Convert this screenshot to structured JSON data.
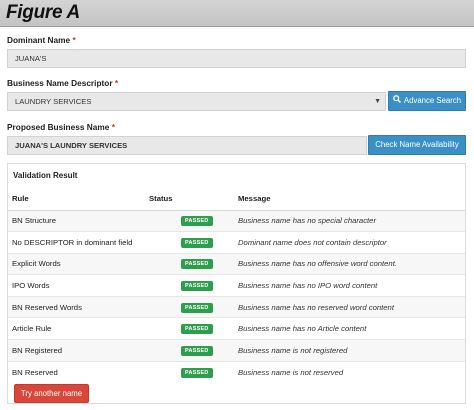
{
  "header": {
    "title": "Figure A"
  },
  "dominant_name": {
    "label": "Dominant Name",
    "required_mark": "*",
    "value": "JUANA'S"
  },
  "descriptor": {
    "label": "Business Name Descriptor",
    "required_mark": "*",
    "value": "LAUNDRY SERVICES",
    "advanced_search_label": "Advance Search"
  },
  "proposed": {
    "label": "Proposed Business Name",
    "required_mark": "*",
    "value": "JUANA'S LAUNDRY SERVICES",
    "check_label": "Check Name Availability"
  },
  "validation": {
    "title": "Validation Result",
    "columns": [
      "Rule",
      "Status",
      "Message"
    ],
    "rows": [
      {
        "rule": "BN Structure",
        "status": "PASSED",
        "message": "Business name has no special character"
      },
      {
        "rule": "No DESCRIPTOR in dominant field",
        "status": "PASSED",
        "message": "Dominant name does not contain descriptor"
      },
      {
        "rule": "Explicit Words",
        "status": "PASSED",
        "message": "Business name has no offensive word content."
      },
      {
        "rule": "IPO Words",
        "status": "PASSED",
        "message": "Business name has no IPO word content"
      },
      {
        "rule": "BN Reserved Words",
        "status": "PASSED",
        "message": "Business name has no reserved word content"
      },
      {
        "rule": "Article Rule",
        "status": "PASSED",
        "message": "Business name has no Article content"
      },
      {
        "rule": "BN Registered",
        "status": "PASSED",
        "message": "Business name is not registered"
      },
      {
        "rule": "BN Reserved",
        "status": "PASSED",
        "message": "Business name is not reserved"
      }
    ],
    "retry_label": "Try another name"
  },
  "colors": {
    "primary_button": "#3a8fc6",
    "passed_badge": "#2e9e4c",
    "retry_button": "#d9473b",
    "required_mark": "#c0392b"
  },
  "icons": {
    "advanced_search": "search-icon",
    "select": "chevron-down-icon"
  }
}
